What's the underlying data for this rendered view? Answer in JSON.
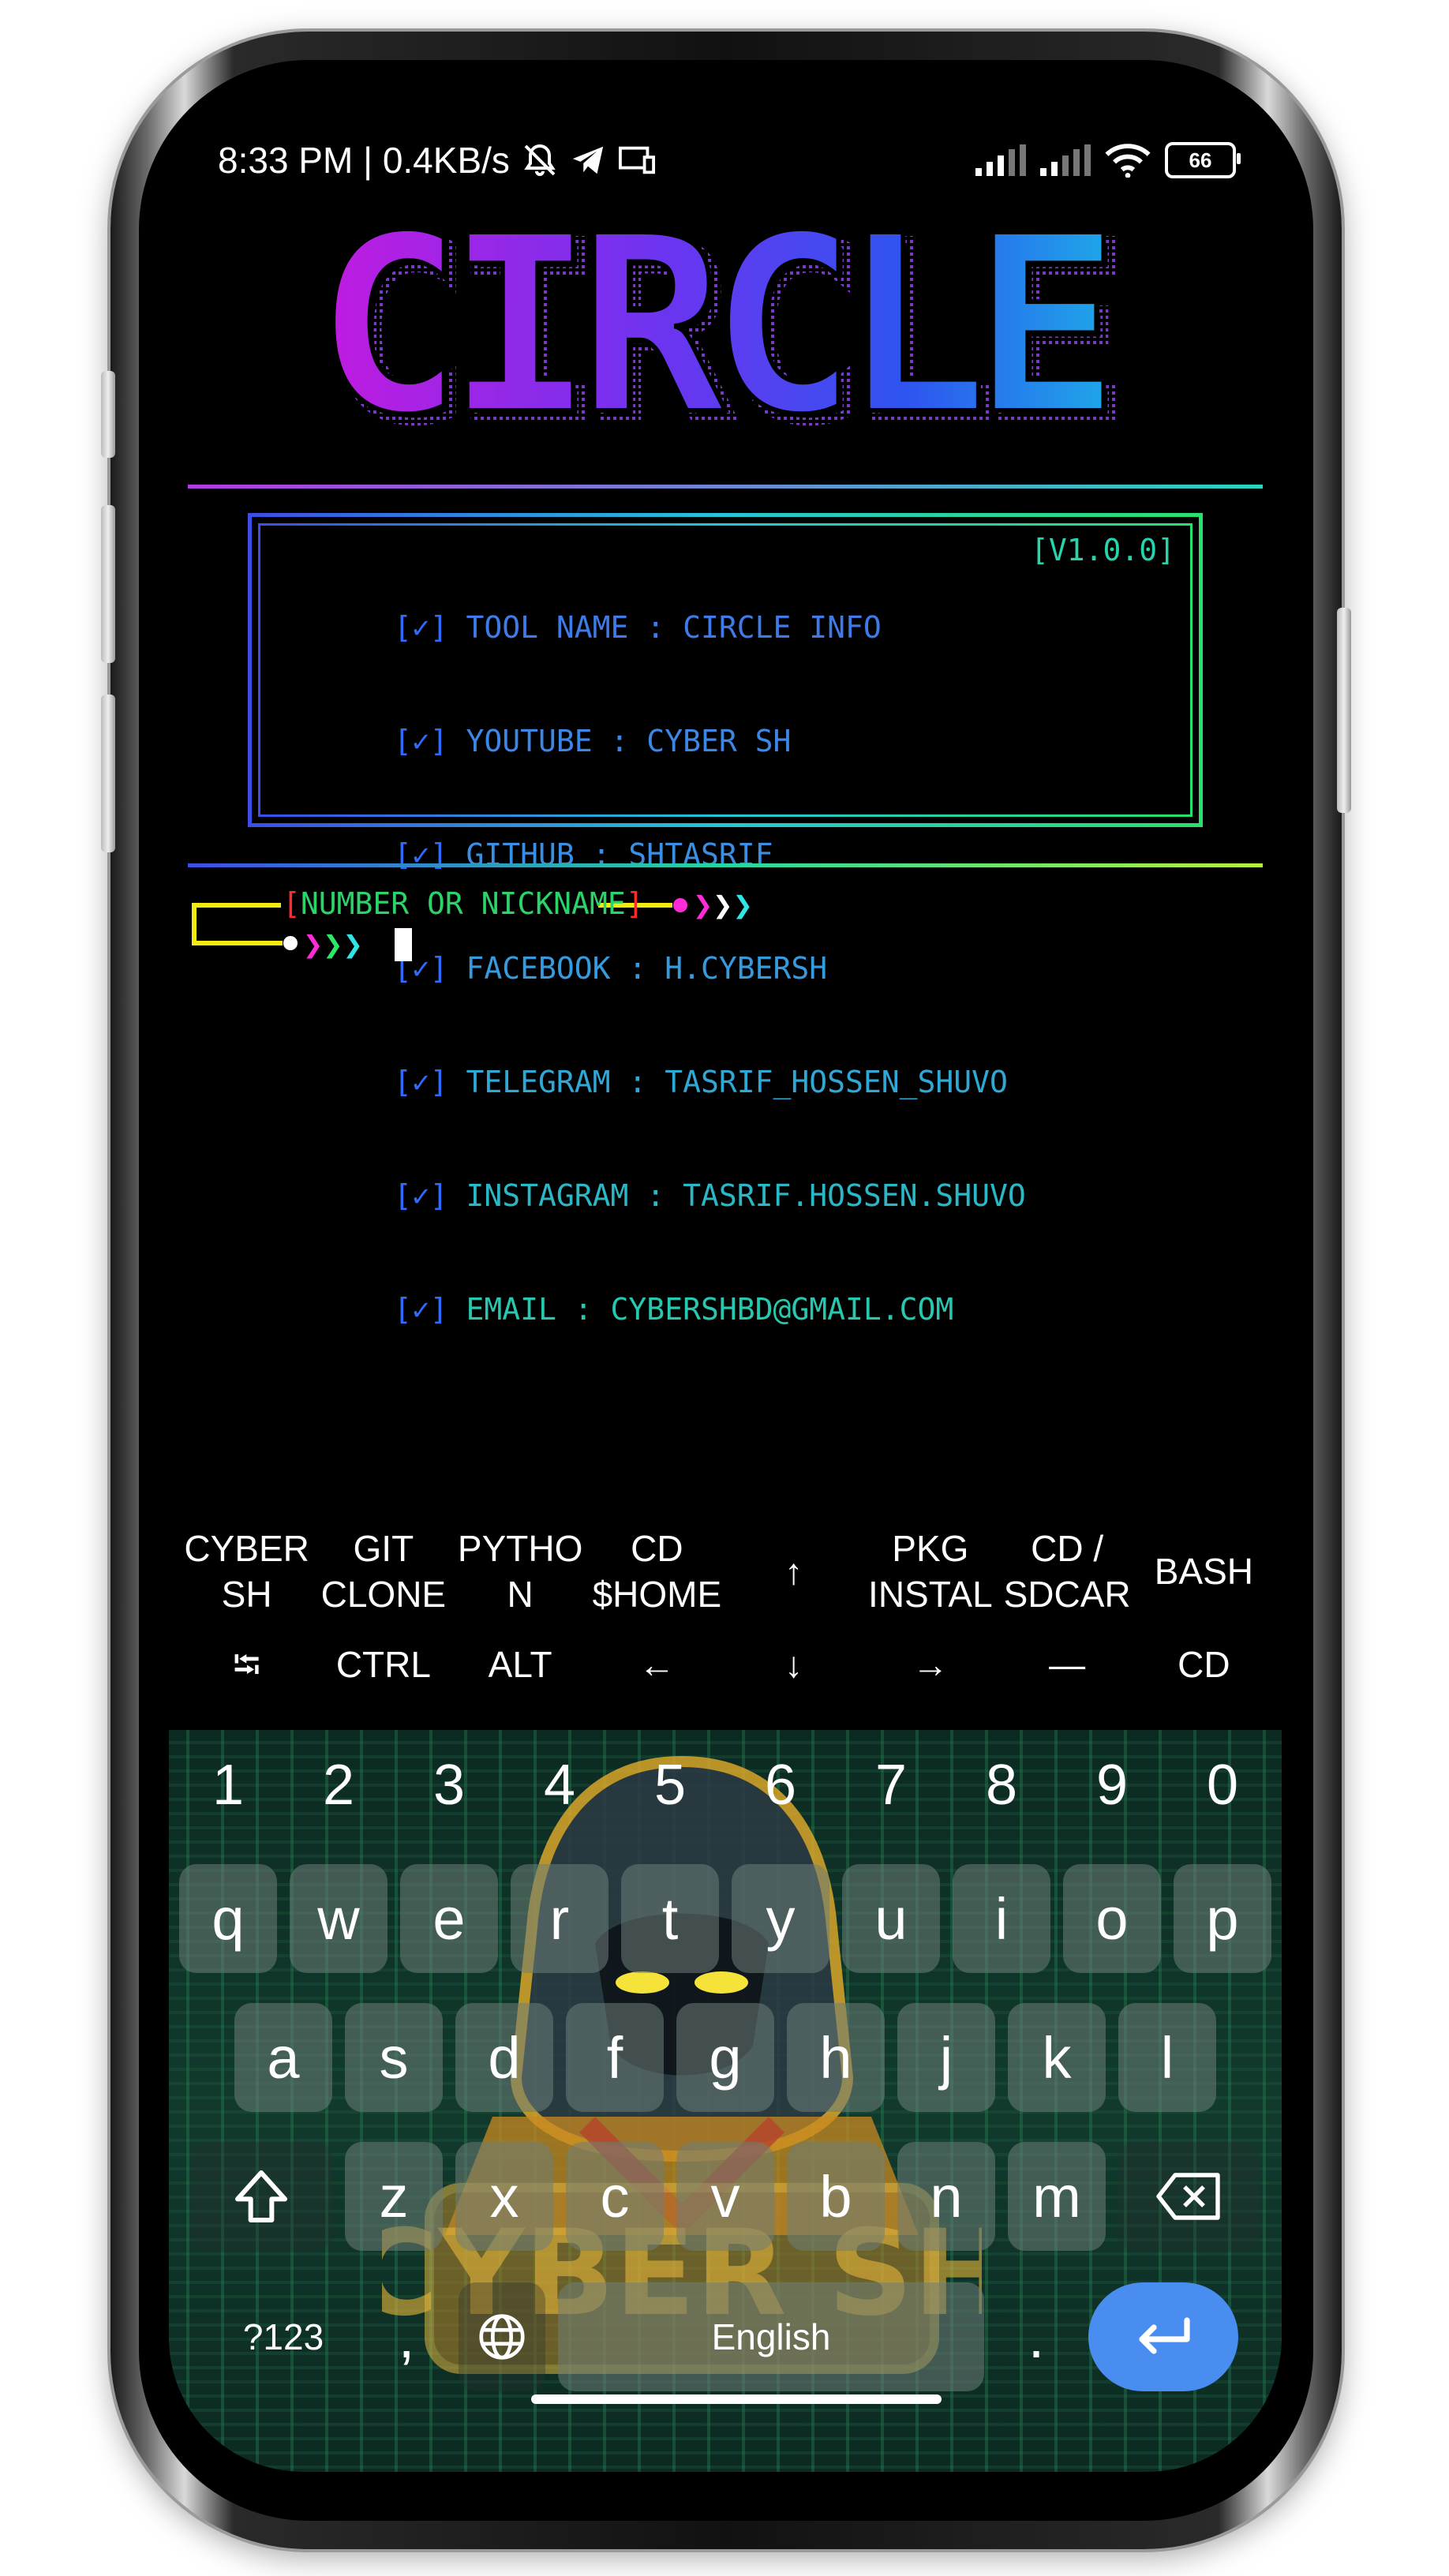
{
  "status_bar": {
    "time_speed": "8:33 PM | 0.4KB/s",
    "battery": "66"
  },
  "logo": {
    "text": "CIRCLE"
  },
  "info": {
    "check": "[✓]",
    "version": "[V1.0.0]",
    "lines": [
      "TOOL NAME : CIRCLE INFO",
      "YOUTUBE : CYBER SH",
      "GITHUB : SHTASRIF",
      "FACEBOOK : H.CYBERSH",
      "TELEGRAM : TASRIF_HOSSEN_SHUVO",
      "INSTAGRAM : TASRIF.HOSSEN.SHUVO",
      "EMAIL : CYBERSHBD@GMAIL.COM"
    ]
  },
  "prompt": {
    "bracket_open": "[",
    "label": "NUMBER OR NICKNAME",
    "bracket_close": "]",
    "arrows": "❯❯❯"
  },
  "extra_keys": {
    "row1": [
      "CYBER\nSH",
      "GIT\nCLONE",
      "PYTHO\nN",
      "CD\n$HOME",
      "↑",
      "PKG\nINSTAL",
      "CD /\nSDCAR",
      "BASH"
    ],
    "row2": [
      "⭾",
      "CTRL",
      "ALT",
      "←",
      "↓",
      "→",
      "—",
      "CD"
    ]
  },
  "keyboard": {
    "numbers": [
      "1",
      "2",
      "3",
      "4",
      "5",
      "6",
      "7",
      "8",
      "9",
      "0"
    ],
    "row_q": [
      "q",
      "w",
      "e",
      "r",
      "t",
      "y",
      "u",
      "i",
      "o",
      "p"
    ],
    "row_a": [
      "a",
      "s",
      "d",
      "f",
      "g",
      "h",
      "j",
      "k",
      "l"
    ],
    "row_z": [
      "z",
      "x",
      "c",
      "v",
      "b",
      "n",
      "m"
    ],
    "symbols_label": "?123",
    "comma": ",",
    "space_label": "English",
    "period": ".",
    "mascot_text": "CYBER SH",
    "colors": {
      "enter": "#4a8df0"
    }
  }
}
